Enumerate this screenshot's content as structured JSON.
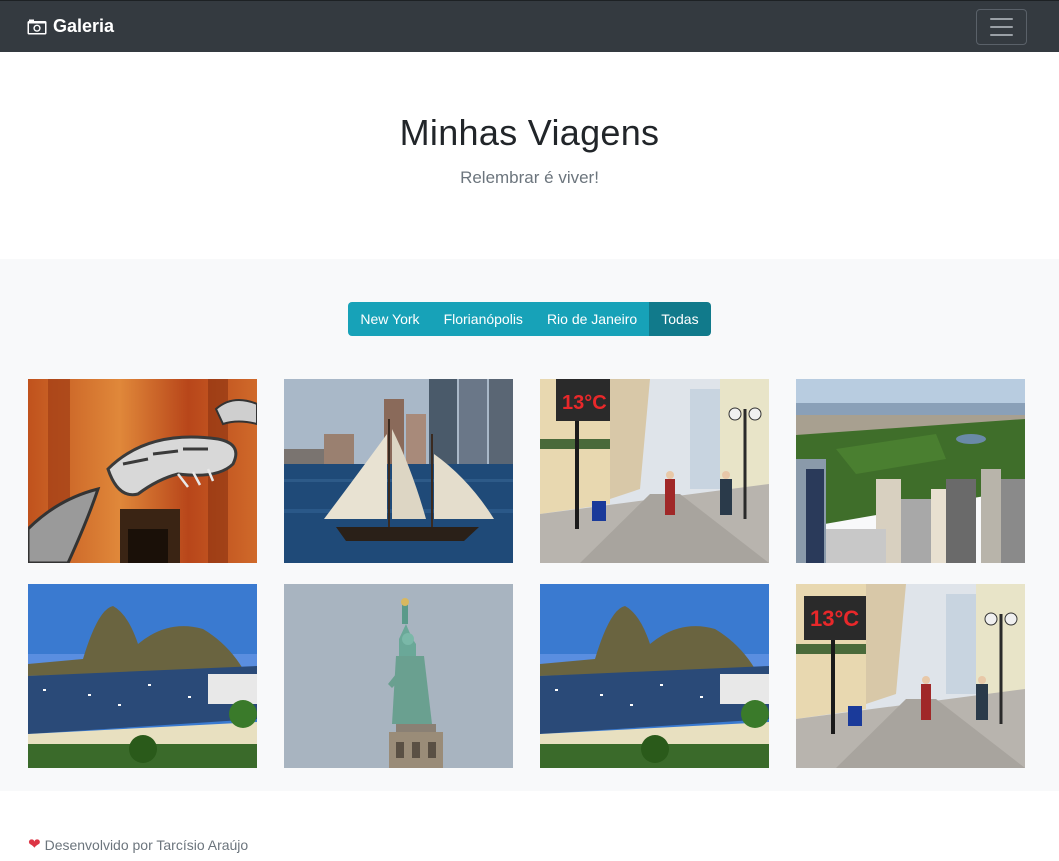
{
  "navbar": {
    "brand": "Galeria",
    "brand_icon": "camera-icon",
    "toggler_icon": "hamburger-menu-icon"
  },
  "hero": {
    "title": "Minhas Viagens",
    "subtitle": "Relembrar é viver!"
  },
  "filters": {
    "buttons": [
      {
        "label": "New York",
        "active": false
      },
      {
        "label": "Florianópolis",
        "active": false
      },
      {
        "label": "Rio de Janeiro",
        "active": false
      },
      {
        "label": "Todas",
        "active": true
      }
    ],
    "color": "#17a2b8",
    "active_color": "#117a8b"
  },
  "photos": [
    {
      "subject": "dinosaur-skeleton",
      "city": "New York"
    },
    {
      "subject": "sailboat-hudson",
      "city": "New York"
    },
    {
      "subject": "pedestrian-street-thermometer",
      "city": "Florianópolis",
      "sign": "13°C"
    },
    {
      "subject": "central-park-aerial",
      "city": "New York"
    },
    {
      "subject": "sugarloaf-bay",
      "city": "Rio de Janeiro"
    },
    {
      "subject": "statue-of-liberty",
      "city": "New York"
    },
    {
      "subject": "sugarloaf-bay",
      "city": "Rio de Janeiro"
    },
    {
      "subject": "pedestrian-street-thermometer",
      "city": "Florianópolis",
      "sign": "13°C"
    }
  ],
  "footer": {
    "icon": "heart-icon",
    "text": "Desenvolvido por Tarcísio Araújo"
  }
}
